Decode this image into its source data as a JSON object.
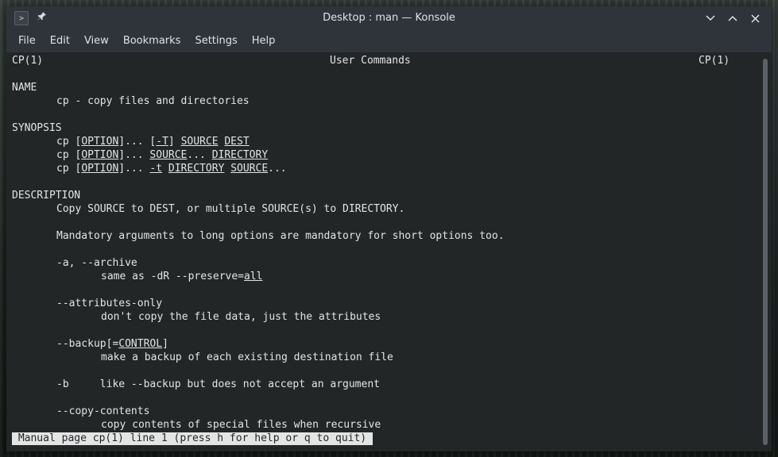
{
  "window": {
    "title": "Desktop : man — Konsole",
    "app_icon_glyph": ">",
    "pin_glyph": "📌",
    "minimize_glyph": "∨",
    "maximize_glyph": "∧",
    "close_glyph": "✕"
  },
  "menu": [
    "File",
    "Edit",
    "View",
    "Bookmarks",
    "Settings",
    "Help"
  ],
  "header": {
    "left": "CP(1)",
    "center": "User Commands",
    "right": "CP(1)"
  },
  "name": {
    "heading": "NAME",
    "text": "cp - copy files and directories"
  },
  "synopsis": {
    "heading": "SYNOPSIS",
    "lines": [
      [
        {
          "t": "cp "
        },
        {
          "t": "[",
          "u": false
        },
        {
          "t": "OPTION",
          "u": true
        },
        {
          "t": "]... [",
          "u": false
        },
        {
          "t": "-T",
          "u": true
        },
        {
          "t": "] "
        },
        {
          "t": "SOURCE",
          "u": true
        },
        {
          "t": " "
        },
        {
          "t": "DEST",
          "u": true
        }
      ],
      [
        {
          "t": "cp "
        },
        {
          "t": "["
        },
        {
          "t": "OPTION",
          "u": true
        },
        {
          "t": "]... "
        },
        {
          "t": "SOURCE",
          "u": true
        },
        {
          "t": "... "
        },
        {
          "t": "DIRECTORY",
          "u": true
        }
      ],
      [
        {
          "t": "cp "
        },
        {
          "t": "["
        },
        {
          "t": "OPTION",
          "u": true
        },
        {
          "t": "]... "
        },
        {
          "t": "-t",
          "u": true
        },
        {
          "t": " "
        },
        {
          "t": "DIRECTORY",
          "u": true
        },
        {
          "t": " "
        },
        {
          "t": "SOURCE",
          "u": true
        },
        {
          "t": "..."
        }
      ]
    ]
  },
  "description": {
    "heading": "DESCRIPTION",
    "intro": "Copy SOURCE to DEST, or multiple SOURCE(s) to DIRECTORY.",
    "mandatory": "Mandatory arguments to long options are mandatory for short options too.",
    "opt_archive": "-a, --archive",
    "opt_archive_desc_prefix": "same as -dR --preserve=",
    "opt_archive_desc_link": "all",
    "opt_attr": "--attributes-only",
    "opt_attr_desc": "don't copy the file data, just the attributes",
    "opt_backup_prefix": "--backup[=",
    "opt_backup_link": "CONTROL",
    "opt_backup_suffix": "]",
    "opt_backup_desc": "make a backup of each existing destination file",
    "opt_b": "-b     like --backup but does not accept an argument",
    "opt_copy": "--copy-contents",
    "opt_copy_desc": "copy contents of special files when recursive"
  },
  "status": " Manual page cp(1) line 1 (press h for help or q to quit) "
}
